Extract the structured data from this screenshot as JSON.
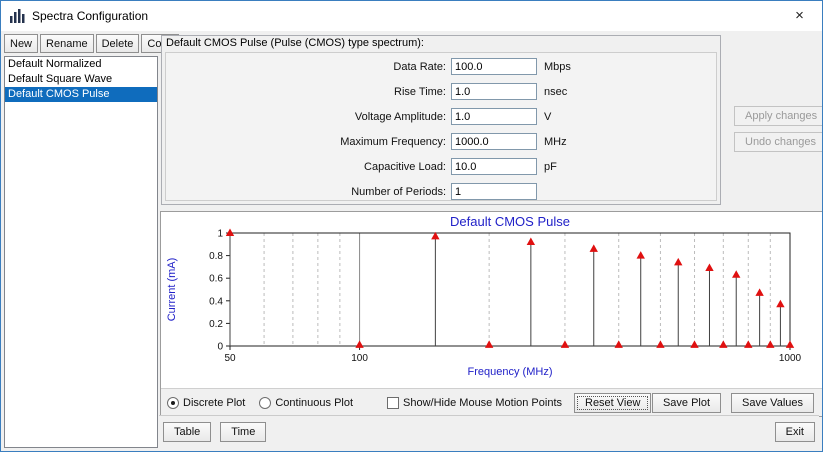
{
  "window": {
    "title": "Spectra Configuration",
    "close_glyph": "×"
  },
  "sidebar": {
    "selection_color": "#0f6cbd",
    "buttons": [
      {
        "label": "New"
      },
      {
        "label": "Rename"
      },
      {
        "label": "Delete"
      },
      {
        "label": "Copy"
      }
    ],
    "items": [
      {
        "label": "Default Normalized",
        "selected": false
      },
      {
        "label": "Default Square Wave",
        "selected": false
      },
      {
        "label": "Default CMOS Pulse",
        "selected": true
      }
    ]
  },
  "form": {
    "group_title": "Default CMOS Pulse (Pulse (CMOS) type spectrum):",
    "fields": [
      {
        "label": "Data Rate:",
        "value": "100.0",
        "unit": "Mbps"
      },
      {
        "label": "Rise Time:",
        "value": "1.0",
        "unit": "nsec"
      },
      {
        "label": "Voltage Amplitude:",
        "value": "1.0",
        "unit": "V"
      },
      {
        "label": "Maximum Frequency:",
        "value": "1000.0",
        "unit": "MHz"
      },
      {
        "label": "Capacitive Load:",
        "value": "10.0",
        "unit": "pF"
      },
      {
        "label": "Number of Periods:",
        "value": "1",
        "unit": ""
      }
    ],
    "apply_label": "Apply changes",
    "undo_label": "Undo changes"
  },
  "chart_data": {
    "type": "stem",
    "title": "Default CMOS Pulse",
    "xlabel": "Frequency (MHz)",
    "ylabel": "Current (mA)",
    "x_scale": "log",
    "xlim": [
      50,
      1000
    ],
    "ylim": [
      0,
      1
    ],
    "x_ticks": [
      50,
      100,
      1000
    ],
    "y_ticks": [
      0,
      0.2,
      0.4,
      0.6,
      0.8,
      1
    ],
    "grid_minor_x": [
      60,
      70,
      80,
      90,
      200,
      300,
      400,
      500,
      600,
      700,
      800,
      900
    ],
    "grid_major_x": [
      100
    ],
    "points": [
      {
        "x": 50,
        "y": 1.0
      },
      {
        "x": 100,
        "y": 0.01
      },
      {
        "x": 150,
        "y": 0.97
      },
      {
        "x": 200,
        "y": 0.01
      },
      {
        "x": 250,
        "y": 0.92
      },
      {
        "x": 300,
        "y": 0.01
      },
      {
        "x": 350,
        "y": 0.86
      },
      {
        "x": 400,
        "y": 0.01
      },
      {
        "x": 450,
        "y": 0.8
      },
      {
        "x": 500,
        "y": 0.01
      },
      {
        "x": 550,
        "y": 0.74
      },
      {
        "x": 600,
        "y": 0.01
      },
      {
        "x": 650,
        "y": 0.69
      },
      {
        "x": 700,
        "y": 0.01
      },
      {
        "x": 750,
        "y": 0.63
      },
      {
        "x": 800,
        "y": 0.01
      },
      {
        "x": 850,
        "y": 0.47
      },
      {
        "x": 900,
        "y": 0.01
      },
      {
        "x": 950,
        "y": 0.37
      },
      {
        "x": 1000,
        "y": 0.01
      }
    ],
    "marker_color": "#e01010",
    "stem_color": "#404040",
    "label_color": "#2121c8"
  },
  "plot_controls": {
    "radios": [
      {
        "label": "Discrete Plot",
        "selected": true
      },
      {
        "label": "Continuous Plot",
        "selected": false
      }
    ],
    "checkbox": {
      "label": "Show/Hide Mouse Motion Points",
      "checked": false
    },
    "reset_label": "Reset View",
    "save_plot_label": "Save Plot",
    "save_values_label": "Save Values"
  },
  "footer": {
    "table_label": "Table",
    "time_label": "Time",
    "exit_label": "Exit"
  }
}
